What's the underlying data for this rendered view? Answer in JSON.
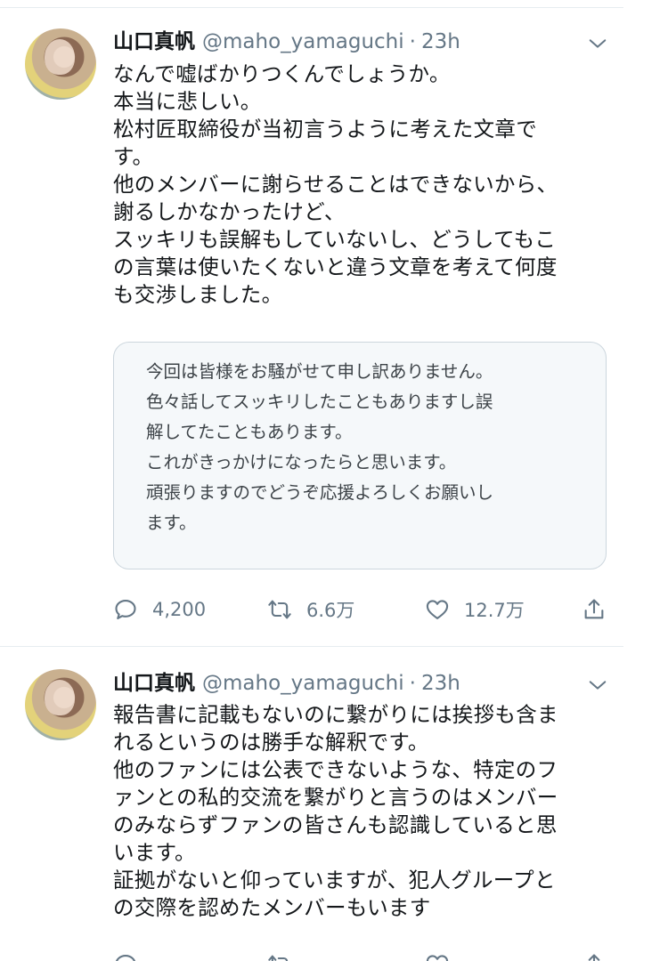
{
  "tweets": [
    {
      "name": "山口真帆",
      "handle": "@maho_yamaguchi",
      "dot": "·",
      "time": "23h",
      "body": "なんで嘘ばかりつくんでしょうか。\n本当に悲しい。\n松村匠取締役が当初言うように考えた文章で\nす。\n他のメンバーに謝らせることはできないから、\n謝るしかなかったけど、\nスッキリも誤解もしていないし、どうしてもこ\nの言葉は使いたくないと違う文章を考えて何度\nも交渉しました。",
      "quote": "今回は皆様をお騒がせて申し訳ありません。\n色々話してスッキリしたこともありますし誤\n解してたこともあります。\nこれがきっかけになったらと思います。\n頑張りますのでどうぞ応援よろしくお願いし\nます。",
      "actions": {
        "reply_count": "4,200",
        "retweet_count": "6.6万",
        "like_count": "12.7万"
      }
    },
    {
      "name": "山口真帆",
      "handle": "@maho_yamaguchi",
      "dot": "·",
      "time": "23h",
      "body": "報告書に記載もないのに繋がりには挨拶も含ま\nれるというのは勝手な解釈です。\n他のファンには公表できないような、特定のフ\nァンとの私的交流を繋がりと言うのはメンバー\nのみならずファンの皆さんも認識していると思\nいます。\n証拠がないと仰っていますが、犯人グループと\nの交際を認めたメンバーもいます"
    }
  ],
  "icons": {
    "reply": "reply-icon",
    "retweet": "retweet-icon",
    "like": "heart-icon",
    "share": "share-icon",
    "menu": "chevron-down-icon"
  }
}
